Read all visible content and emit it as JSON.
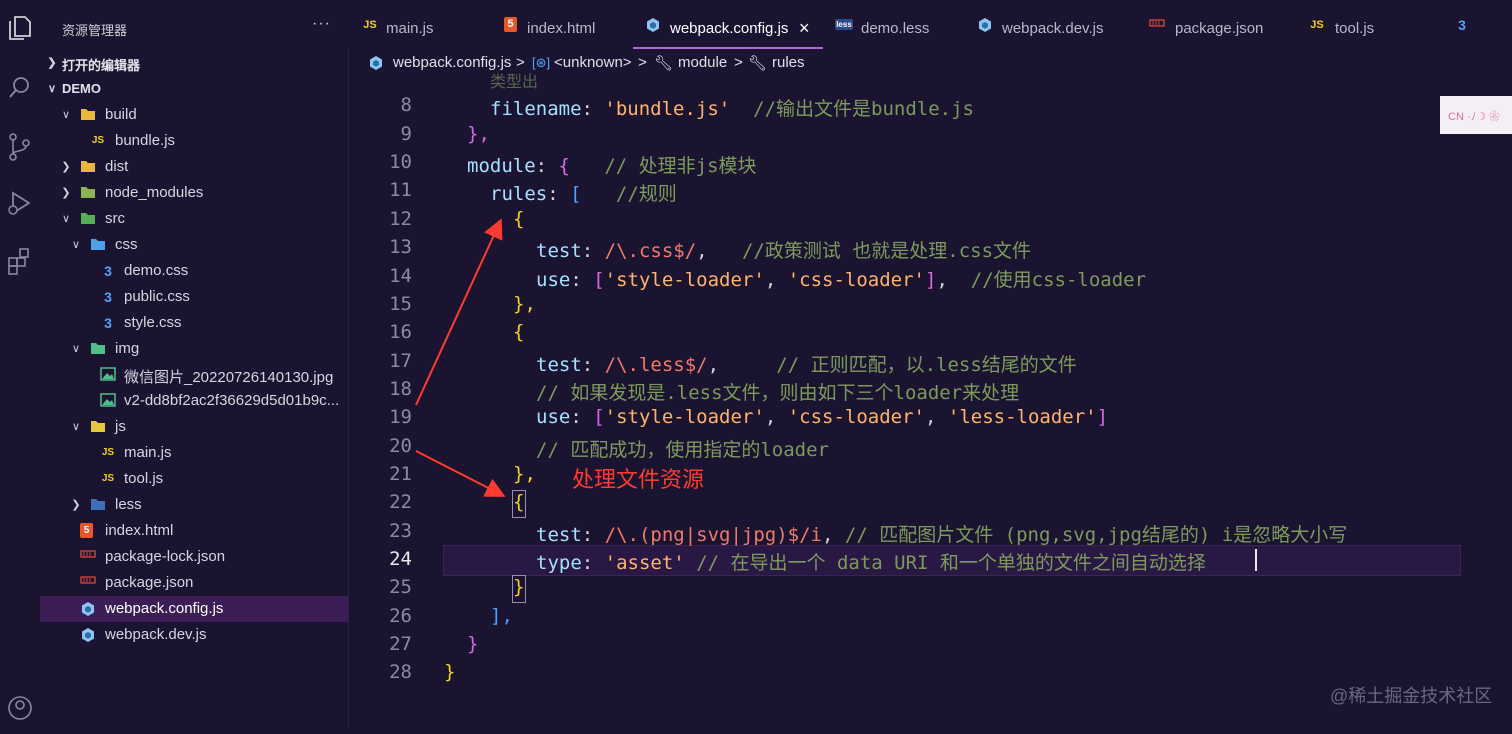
{
  "sidebar": {
    "title": "资源管理器",
    "more": "···",
    "open_editors": "打开的编辑器",
    "root": "DEMO",
    "items": [
      {
        "label": "build",
        "type": "folder"
      },
      {
        "label": "bundle.js",
        "type": "js"
      },
      {
        "label": "dist",
        "type": "folder"
      },
      {
        "label": "node_modules",
        "type": "folder"
      },
      {
        "label": "src",
        "type": "folder"
      },
      {
        "label": "css",
        "type": "folder"
      },
      {
        "label": "demo.css",
        "type": "css"
      },
      {
        "label": "public.css",
        "type": "css"
      },
      {
        "label": "style.css",
        "type": "css"
      },
      {
        "label": "img",
        "type": "folder"
      },
      {
        "label": "微信图片_20220726140130.jpg",
        "type": "img"
      },
      {
        "label": "v2-dd8bf2ac2f36629d5d01b9c...",
        "type": "img"
      },
      {
        "label": "js",
        "type": "folder"
      },
      {
        "label": "main.js",
        "type": "js"
      },
      {
        "label": "tool.js",
        "type": "js"
      },
      {
        "label": "less",
        "type": "folder"
      },
      {
        "label": "index.html",
        "type": "html"
      },
      {
        "label": "package-lock.json",
        "type": "json"
      },
      {
        "label": "package.json",
        "type": "json"
      },
      {
        "label": "webpack.config.js",
        "type": "webpack"
      },
      {
        "label": "webpack.dev.js",
        "type": "webpack"
      }
    ]
  },
  "tabs": [
    {
      "label": "main.js",
      "icon": "JS"
    },
    {
      "label": "index.html",
      "icon": "5"
    },
    {
      "label": "webpack.config.js",
      "icon": "webpack",
      "close": "×"
    },
    {
      "label": "demo.less",
      "icon": "less"
    },
    {
      "label": "webpack.dev.js",
      "icon": "webpack"
    },
    {
      "label": "package.json",
      "icon": "json"
    },
    {
      "label": "tool.js",
      "icon": "JS"
    }
  ],
  "breadcrumb": {
    "file": "webpack.config.js",
    "sep": ">",
    "unknown": "<unknown>",
    "module": "module",
    "rules": "rules"
  },
  "editor": {
    "top_partial": "类型出",
    "line_numbers": [
      "8",
      "9",
      "10",
      "11",
      "12",
      "13",
      "14",
      "15",
      "16",
      "17",
      "18",
      "19",
      "20",
      "21",
      "22",
      "23",
      "24",
      "25",
      "26",
      "27",
      "28"
    ],
    "current_line": "24",
    "lines": {
      "l8_key": "filename",
      "l8_val": "'bundle.js'",
      "l8_cmt": "//输出文件是bundle.js",
      "l9": "},",
      "l10_key": "module",
      "l10_cmt": "// 处理非js模块",
      "l11_key": "rules",
      "l11_cmt": "//规则",
      "l12": "{",
      "l13_key": "test",
      "l13_re": "/\\.css$/",
      "l13_cmt": "//政策测试 也就是处理.css文件",
      "l14_key": "use",
      "l14_v1": "'style-loader'",
      "l14_v2": "'css-loader'",
      "l14_cmt": "//使用css-loader",
      "l15": "},",
      "l16": "{",
      "l17_key": "test",
      "l17_re": "/\\.less$/",
      "l17_cmt": "// 正则匹配，以.less结尾的文件",
      "l18_cmt": "// 如果发现是.less文件，则由如下三个loader来处理",
      "l19_key": "use",
      "l19_v1": "'style-loader'",
      "l19_v2": "'css-loader'",
      "l19_v3": "'less-loader'",
      "l20_cmt": "// 匹配成功，使用指定的loader",
      "l21": "},",
      "l22": "{",
      "l23_key": "test",
      "l23_re": "/\\.(png|svg|jpg)$/i",
      "l23_cmt": "// 匹配图片文件 (png,svg,jpg结尾的) i是忽略大小写",
      "l24_key": "type",
      "l24_val": "'asset'",
      "l24_cmt": "// 在导出一个 data URI 和一个单独的文件之间自动选择",
      "l25": "}",
      "l26": "],",
      "l27": "}",
      "l28": "}"
    }
  },
  "annotation": "处理文件资源",
  "minimap_label": "CN ·ﾉ☽ ❀",
  "watermark": "@稀土掘金技术社区",
  "colors": {
    "background": "#1b1431",
    "accent": "#a96bd8",
    "annotation": "#ff3b30"
  }
}
